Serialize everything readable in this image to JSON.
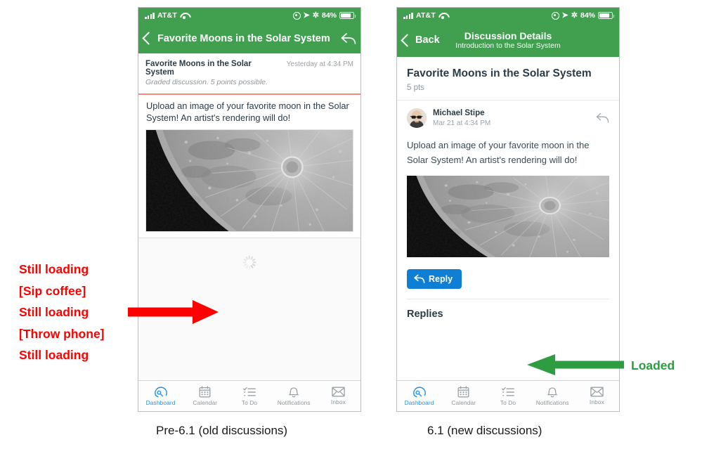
{
  "colors": {
    "brand_green": "#41a04f",
    "accent_blue": "#0e7fd4",
    "annotation_red": "#ff0000",
    "annotation_green": "#2e9c41",
    "graded_rule": "#f0897f"
  },
  "status_bar": {
    "carrier": "AT&T",
    "signal_icon": "signal-bars-icon",
    "wifi_icon": "wifi-icon",
    "alarm_icon": "alarm-clock-icon",
    "location_icon": "location-arrow-icon",
    "bluetooth_icon": "bluetooth-icon",
    "battery_percent": "84%",
    "battery_icon": "battery-icon"
  },
  "left_phone": {
    "nav": {
      "back_icon": "chevron-left-icon",
      "title": "Favorite Moons in the Solar System",
      "reply_icon": "reply-arrow-icon"
    },
    "discussion": {
      "title": "Favorite Moons in the Solar System",
      "date": "Yesterday at 4:34 PM",
      "subtitle": "Graded discussion. 5 points possible.",
      "message": "Upload an image of your favorite moon in the Solar System! An artist's rendering will do!",
      "attachment_alt": "moon-photograph"
    },
    "loading_icon": "loading-spinner-icon"
  },
  "right_phone": {
    "nav": {
      "back_icon": "chevron-left-icon",
      "back_label": "Back",
      "title": "Discussion Details",
      "subtitle": "Introduction to the Solar System"
    },
    "discussion": {
      "title": "Favorite Moons in the Solar System",
      "points": "5 pts",
      "author": "Michael Stipe",
      "date": "Mar 21 at 4:34 PM",
      "avatar_icon": "user-avatar",
      "reply_icon": "reply-arrow-icon",
      "message": "Upload an image of your favorite moon in the Solar System! An artist's rendering will do!",
      "attachment_alt": "moon-photograph",
      "reply_button": "Reply",
      "reply_button_icon": "reply-arrow-icon",
      "replies_heading": "Replies"
    }
  },
  "tabbar": {
    "items": [
      {
        "label": "Dashboard",
        "icon": "dashboard-gauge-icon",
        "active": true
      },
      {
        "label": "Calendar",
        "icon": "calendar-icon",
        "active": false
      },
      {
        "label": "To Do",
        "icon": "checklist-icon",
        "active": false
      },
      {
        "label": "Notifications",
        "icon": "bell-icon",
        "active": false
      },
      {
        "label": "Inbox",
        "icon": "envelope-icon",
        "active": false
      }
    ]
  },
  "annotations": {
    "loading_lines": [
      "Still loading",
      "[Sip coffee]",
      "Still loading",
      "[Throw phone]",
      "Still loading"
    ],
    "red_arrow_icon": "arrow-right-icon",
    "green_arrow_icon": "arrow-left-icon",
    "loaded_label": "Loaded"
  },
  "captions": {
    "left": "Pre-6.1 (old discussions)",
    "right": "6.1 (new discussions)"
  }
}
